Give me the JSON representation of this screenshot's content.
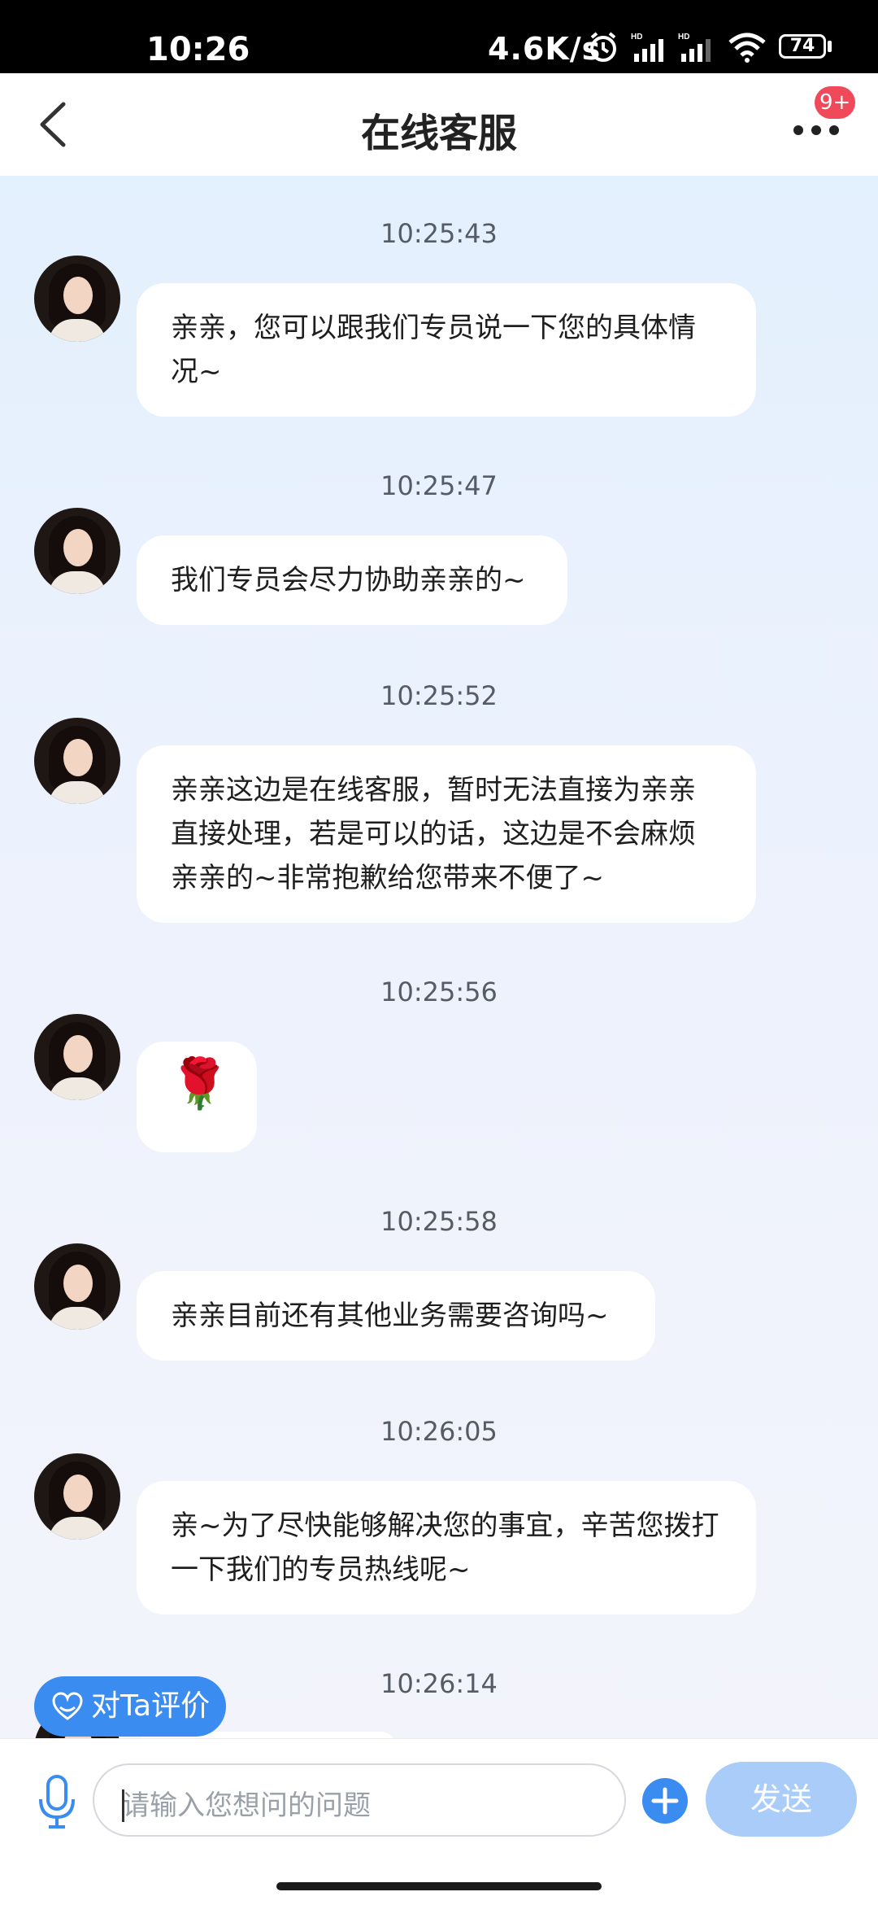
{
  "status_bar": {
    "time": "10:26",
    "speed": "4.6K/s",
    "battery": "74"
  },
  "header": {
    "title": "在线客服",
    "badge": "9+"
  },
  "messages": [
    {
      "time": "10:25:43",
      "text": "亲亲，您可以跟我们专员说一下您的具体情况~"
    },
    {
      "time": "10:25:47",
      "text": "我们专员会尽力协助亲亲的~"
    },
    {
      "time": "10:25:52",
      "text": "亲亲这边是在线客服，暂时无法直接为亲亲直接处理，若是可以的话，这边是不会麻烦亲亲的~非常抱歉给您带来不便了~"
    },
    {
      "time": "10:25:56",
      "text": "🌹"
    },
    {
      "time": "10:25:58",
      "text": "亲亲目前还有其他业务需要咨询吗~"
    },
    {
      "time": "10:26:05",
      "text": "亲~为了尽快能够解决您的事宜，辛苦您拨打一下我们的专员热线呢~"
    },
    {
      "time": "10:26:14",
      "text": ""
    }
  ],
  "rating_button": {
    "label": "对Ta评价"
  },
  "input": {
    "placeholder": "请输入您想问的问题",
    "send_label": "发送"
  },
  "colors": {
    "accent": "#3a8cf1",
    "send_disabled": "#a9cdf8",
    "badge": "#f04a5a"
  },
  "icons": [
    "back-icon",
    "more-icon",
    "mic-icon",
    "plus-icon",
    "heart-badge-icon",
    "alarm-icon",
    "signal-icon",
    "wifi-icon",
    "battery-icon"
  ]
}
